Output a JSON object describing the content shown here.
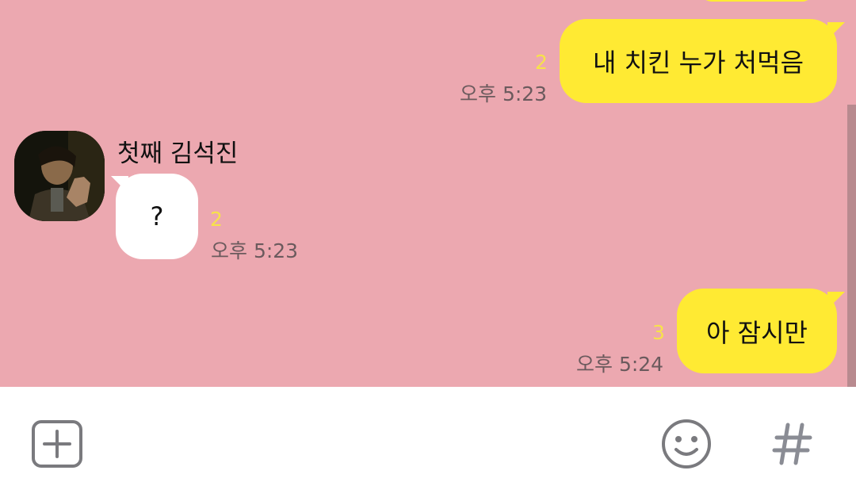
{
  "colors": {
    "chat_background": "#eca8b0",
    "my_bubble": "#ffea33",
    "their_bubble": "#ffffff",
    "unread_count": "#f7e24a",
    "timestamp": "#6b5a5d"
  },
  "messages": [
    {
      "side": "mine",
      "text": "내 치킨 누가 처먹음",
      "unread": "2",
      "time": "오후 5:23"
    },
    {
      "side": "theirs",
      "sender": "첫째 김석진",
      "text": "?",
      "unread": "2",
      "time": "오후 5:23"
    },
    {
      "side": "mine",
      "text": "아 잠시만",
      "unread": "3",
      "time": "오후 5:24"
    }
  ],
  "input_bar": {
    "left_icon": "plus-square-icon",
    "emoji_icon": "smiley-icon",
    "hashtag_icon": "hashtag-icon"
  }
}
